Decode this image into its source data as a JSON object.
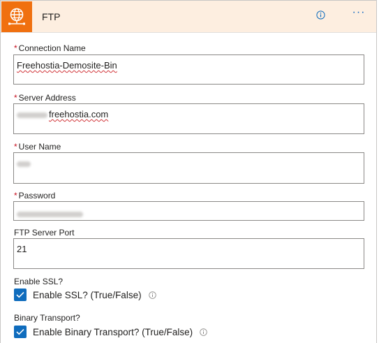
{
  "header": {
    "title": "FTP",
    "info_icon": "info-icon",
    "more_label": "···"
  },
  "fields": {
    "connection_name": {
      "label": "Connection Name",
      "required": "*",
      "value": "Freehostia-Demosite-Bin"
    },
    "server_address": {
      "label": "Server Address",
      "required": "*",
      "value": "freehostia.com"
    },
    "user_name": {
      "label": "User Name",
      "required": "*"
    },
    "password": {
      "label": "Password",
      "required": "*"
    },
    "port": {
      "label": "FTP Server Port",
      "value": "21"
    }
  },
  "ssl": {
    "section_label": "Enable SSL?",
    "checkbox_label": "Enable SSL? (True/False)",
    "checked": true
  },
  "binary": {
    "section_label": "Binary Transport?",
    "checkbox_label": "Enable Binary Transport? (True/False)",
    "checked": true
  },
  "colors": {
    "accent": "#0f6cbd",
    "header_bg": "#fdeee0",
    "logo_bg": "#f0700f",
    "required": "#c50f1f"
  }
}
